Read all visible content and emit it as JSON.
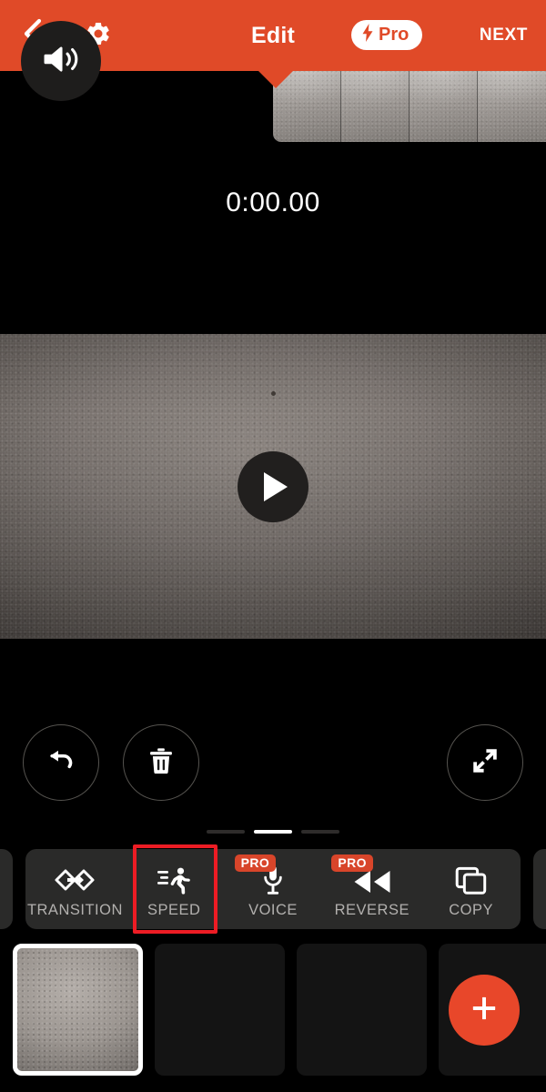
{
  "header": {
    "title": "Edit",
    "back_icon": "chevron-left-icon",
    "settings_icon": "gear-icon",
    "pro_label": "Pro",
    "pro_icon": "lightning-bolt-icon",
    "next_label": "NEXT",
    "background_color": "#E04A28"
  },
  "player": {
    "timecode": "0:00.00",
    "play_icon": "play-triangle-icon",
    "filmstrip_frames": 4
  },
  "actions": {
    "undo": {
      "name": "undo",
      "icon": "undo-arrow-icon"
    },
    "delete": {
      "name": "delete",
      "icon": "trash-icon"
    },
    "expand": {
      "name": "expand",
      "icon": "fullscreen-expand-icon"
    }
  },
  "pager": {
    "count": 3,
    "active_index": 1
  },
  "toolbar": {
    "items": [
      {
        "label": "TRANSITION",
        "icon": "transition-diamonds-icon",
        "pro": false,
        "highlighted": false
      },
      {
        "label": "SPEED",
        "icon": "running-person-icon",
        "pro": false,
        "highlighted": true
      },
      {
        "label": "VOICE",
        "icon": "microphone-icon",
        "pro": true,
        "highlighted": false
      },
      {
        "label": "REVERSE",
        "icon": "reverse-arrows-icon",
        "pro": true,
        "highlighted": false
      },
      {
        "label": "COPY",
        "icon": "copy-squares-icon",
        "pro": false,
        "highlighted": false
      }
    ],
    "pro_tag_label": "PRO",
    "highlight_color": "#ED1C24",
    "pro_tag_color": "#D8452A"
  },
  "clips": {
    "selected_index": 0,
    "mute_icon": "speaker-volume-icon",
    "add_icon": "plus-icon",
    "add_color": "#E8472A",
    "empty_slots": 2
  }
}
